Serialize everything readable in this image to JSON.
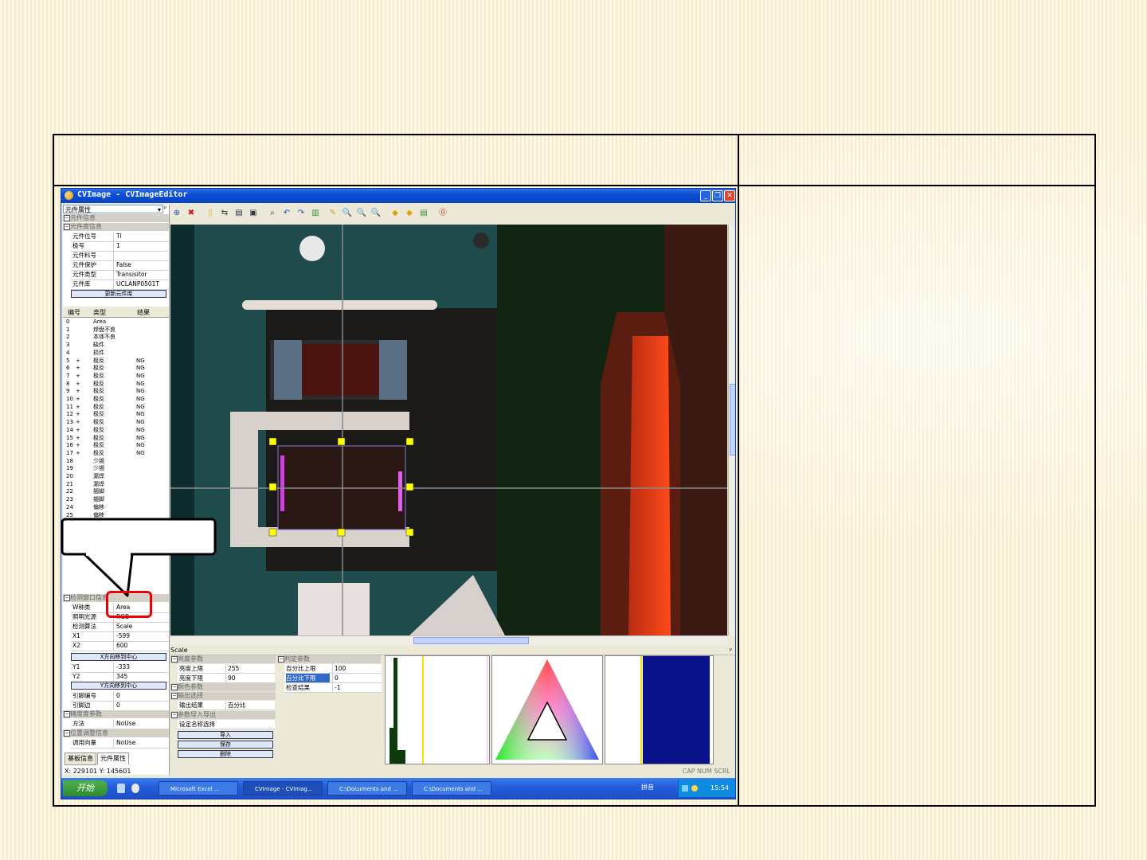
{
  "slide": {
    "header_left": "",
    "header_right": "",
    "right_cell": ""
  },
  "window": {
    "title": "CVImage - CVImageEditor",
    "min": "_",
    "restore": "❐",
    "close": "✕"
  },
  "left_panel": {
    "combo": "元件属性",
    "pin": "▾",
    "pin2": "ᵖ",
    "group1": "元件信息",
    "group2": "元件库信息",
    "props": [
      {
        "k": "元件位号",
        "v": "TI"
      },
      {
        "k": "极号",
        "v": "1"
      },
      {
        "k": "元件料号",
        "v": ""
      },
      {
        "k": "元件保护",
        "v": "False"
      },
      {
        "k": "元件类型",
        "v": "Transisitor"
      },
      {
        "k": "元件库",
        "v": "UCLANP0501T"
      }
    ],
    "select_lib_button": "更新元件库",
    "list_headers": [
      "编号",
      "类型",
      "结果"
    ],
    "list_rows": [
      {
        "n": "0",
        "s": "",
        "t": "Area",
        "r": ""
      },
      {
        "n": "1",
        "s": "",
        "t": "焊盘不良",
        "r": ""
      },
      {
        "n": "2",
        "s": "",
        "t": "本体不良",
        "r": ""
      },
      {
        "n": "3",
        "s": "",
        "t": "缺件",
        "r": ""
      },
      {
        "n": "4",
        "s": "",
        "t": "损件",
        "r": ""
      },
      {
        "n": "5",
        "s": "+",
        "t": "极反",
        "r": "NG"
      },
      {
        "n": "6",
        "s": "+",
        "t": "极反",
        "r": "NG"
      },
      {
        "n": "7",
        "s": "+",
        "t": "极反",
        "r": "NG"
      },
      {
        "n": "8",
        "s": "+",
        "t": "极反",
        "r": "NG"
      },
      {
        "n": "9",
        "s": "+",
        "t": "极反",
        "r": "NG"
      },
      {
        "n": "10",
        "s": "+",
        "t": "极反",
        "r": "NG"
      },
      {
        "n": "11",
        "s": "+",
        "t": "极反",
        "r": "NG"
      },
      {
        "n": "12",
        "s": "+",
        "t": "极反",
        "r": "NG"
      },
      {
        "n": "13",
        "s": "+",
        "t": "极反",
        "r": "NG"
      },
      {
        "n": "14",
        "s": "+",
        "t": "极反",
        "r": "NG"
      },
      {
        "n": "15",
        "s": "+",
        "t": "极反",
        "r": "NG"
      },
      {
        "n": "16",
        "s": "+",
        "t": "极反",
        "r": "NG"
      },
      {
        "n": "17",
        "s": "+",
        "t": "极反",
        "r": "NG"
      },
      {
        "n": "18",
        "s": "",
        "t": "少锡",
        "r": ""
      },
      {
        "n": "19",
        "s": "",
        "t": "少锡",
        "r": ""
      },
      {
        "n": "20",
        "s": "",
        "t": "漏焊",
        "r": ""
      },
      {
        "n": "21",
        "s": "",
        "t": "漏焊",
        "r": ""
      },
      {
        "n": "22",
        "s": "",
        "t": "翘脚",
        "r": ""
      },
      {
        "n": "23",
        "s": "",
        "t": "翘脚",
        "r": ""
      },
      {
        "n": "24",
        "s": "",
        "t": "偏移",
        "r": ""
      },
      {
        "n": "25",
        "s": "",
        "t": "偏移",
        "r": ""
      }
    ],
    "group3": "检测窗口信息",
    "window_props": [
      {
        "k": "W种类",
        "v": "Area"
      },
      {
        "k": "照明光源",
        "v": "RGB"
      },
      {
        "k": "检测算法",
        "v": "Scale"
      },
      {
        "k": "X1",
        "v": "-599"
      },
      {
        "k": "X2",
        "v": "600"
      }
    ],
    "x_center_button": "X方向移到中心",
    "window_props2": [
      {
        "k": "Y1",
        "v": "-333"
      },
      {
        "k": "Y2",
        "v": "345"
      }
    ],
    "y_center_button": "Y方向移到中心",
    "window_props3": [
      {
        "k": "引脚编号",
        "v": "0"
      },
      {
        "k": "引脚边",
        "v": "0"
      }
    ],
    "group4": "精度度参数",
    "method": {
      "k": "方法",
      "v": "NoUse"
    },
    "group5": "位置调整信息",
    "adjust": {
      "k": "调用向量",
      "v": "NoUse"
    },
    "tabs": [
      "基板信息",
      "元件属性"
    ]
  },
  "toolbar": [
    "⊕",
    "✖",
    "▯",
    "⇆",
    "▤",
    "▣",
    "⌕",
    "↶",
    "↷",
    "▥",
    "✎",
    "🔍",
    "🔍",
    "🔍",
    "◆",
    "◆",
    "▤",
    "⓪"
  ],
  "bottom": {
    "title": "Scale",
    "pin": "ᵖ",
    "brightness_section": "亮度参数",
    "brightness_rows": [
      {
        "k": "亮度上限",
        "v": "255"
      },
      {
        "k": "亮度下限",
        "v": "90"
      }
    ],
    "color_section": "颜色参数",
    "output_section": "输出选择",
    "output_row": {
      "k": "输出结果",
      "v": "百分比"
    },
    "io_section": "参数导入导出",
    "io_row": {
      "k": "设定名称选择",
      "v": ""
    },
    "io_buttons": [
      "导入",
      "保存",
      "删除"
    ],
    "judge_section": "判定参数",
    "judge_rows": [
      {
        "k": "百分比上限",
        "v": "100"
      },
      {
        "k": "百分比下限",
        "v": "0"
      },
      {
        "k": "检查结果",
        "v": "-1"
      }
    ]
  },
  "statusbar": {
    "coords": "X: 229101 Y: 145601",
    "indicators": "CAP  NUM  SCRL"
  },
  "taskbar": {
    "start": "开始",
    "tasks": [
      "Microsoft Excel ...",
      "CVImage - CVImag...",
      "C:\\Documents and ...",
      "C:\\Documents and ..."
    ],
    "ime": "拼音",
    "clock": "15:54"
  },
  "colors": {
    "accent_red": "#e00000",
    "selection_yellow": "#ffff00",
    "pcb_teal": "#1f4b4c"
  }
}
